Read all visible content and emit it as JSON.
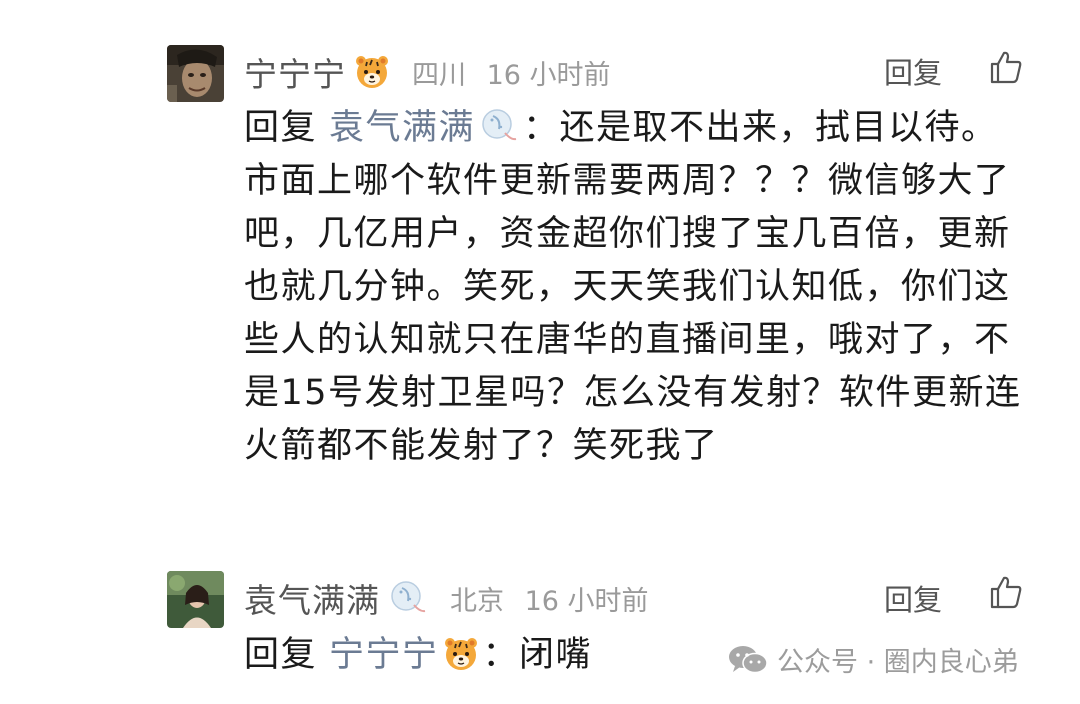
{
  "comments": [
    {
      "username": "宁宁宁",
      "badge_icon": "tiger-icon",
      "location": "四川",
      "time": "16 小时前",
      "reply_label": "回复",
      "like_icon": "thumbs-up-icon",
      "reply_prefix": "回复",
      "reply_to": "袁气满满",
      "reply_to_badge_icon": "moon-icon",
      "text": "：还是取不出来，拭目以待。市面上哪个软件更新需要两周？？？微信够大了吧，几亿用户，资金超你们搜了宝几百倍，更新也就几分钟。笑死，天天笑我们认知低，你们这些人的认知就只在唐华的直播间里，哦对了，不是15号发射卫星吗？怎么没有发射？软件更新连火箭都不能发射了？笑死我了"
    },
    {
      "username": "袁气满满",
      "badge_icon": "moon-icon",
      "location": "北京",
      "time": "16 小时前",
      "reply_label": "回复",
      "like_icon": "thumbs-up-icon",
      "reply_prefix": "回复",
      "reply_to": "宁宁宁",
      "reply_to_badge_icon": "tiger-icon",
      "text": "：闭嘴"
    }
  ],
  "watermark": {
    "icon": "wechat-icon",
    "text": "公众号 · 圈内良心弟"
  }
}
